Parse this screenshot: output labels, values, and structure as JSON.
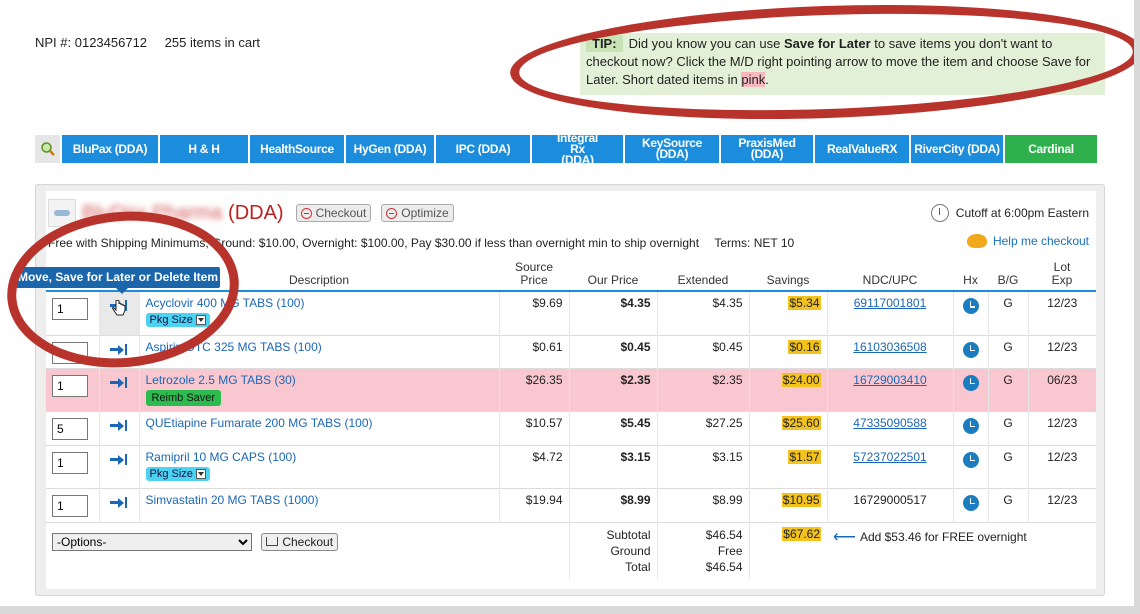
{
  "header": {
    "npi": "NPI #: 0123456712",
    "cart_count": "255 items in cart"
  },
  "tip": {
    "label": "TIP:",
    "text_1": "Did you know you can use ",
    "bold": "Save for Later",
    "text_2": " to save items you don't want to checkout now? Click the M/D right pointing arrow to move the item and choose Save for Later. Short dated items in ",
    "pink": "pink",
    "text_3": "."
  },
  "vendor_tabs": [
    {
      "label": "BluPax (DDA)",
      "color": "#1c8ddc"
    },
    {
      "label": "H & H",
      "color": "#1c8ddc"
    },
    {
      "label": "HealthSource",
      "color": "#1c8ddc"
    },
    {
      "label": "HyGen (DDA)",
      "color": "#1c8ddc"
    },
    {
      "label": "IPC (DDA)",
      "color": "#1c8ddc"
    },
    {
      "label": "Integral Rx (DDA)",
      "color": "#1c8ddc"
    },
    {
      "label": "KeySource (DDA)",
      "color": "#1c8ddc"
    },
    {
      "label": "PraxisMed (DDA)",
      "color": "#1c8ddc"
    },
    {
      "label": "RealValueRX",
      "color": "#1c8ddc"
    },
    {
      "label": "RiverCity (DDA)",
      "color": "#1c8ddc"
    },
    {
      "label": "Cardinal",
      "color": "#2eb14d"
    }
  ],
  "vendor": {
    "name_blurred": "BluDirx Pharma",
    "suffix": "(DDA)",
    "checkout_label": "Checkout",
    "optimize_label": "Optimize",
    "cutoff": "Cutoff at 6:00pm Eastern",
    "shipping": "Free with Shipping Minimums, Ground: $10.00, Overnight: $100.00, Pay $30.00 if less than overnight min to ship overnight",
    "terms": "Terms: NET 10",
    "help": "Help me checkout"
  },
  "tooltip": "Move, Save for Later or Delete Item",
  "columns": {
    "description": "Description",
    "source_price_1": "Source",
    "source_price_2": "Price",
    "our_price": "Our Price",
    "extended": "Extended",
    "savings": "Savings",
    "ndc": "NDC/UPC",
    "hx": "Hx",
    "bg": "B/G",
    "lot_1": "Lot",
    "lot_2": "Exp"
  },
  "rows": [
    {
      "qty": "1",
      "desc": "Acyclovir 400 MG TABS (100)",
      "badge": "Pkg Size",
      "source": "$9.69",
      "our": "$4.35",
      "ext": "$4.35",
      "savings": "$5.34",
      "ndc": "69117001801",
      "bg": "G",
      "lot": "12/23"
    },
    {
      "qty": "1",
      "desc": "Aspirin OTC 325 MG TABS (100)",
      "badge": "",
      "source": "$0.61",
      "our": "$0.45",
      "ext": "$0.45",
      "savings": "$0.16",
      "ndc": "16103036508",
      "bg": "G",
      "lot": "12/23"
    },
    {
      "qty": "1",
      "desc": "Letrozole 2.5 MG TABS (30)",
      "badge": "Reimb Saver",
      "source": "$26.35",
      "our": "$2.35",
      "ext": "$2.35",
      "savings": "$24.00",
      "ndc": "16729003410",
      "bg": "G",
      "lot": "06/23"
    },
    {
      "qty": "5",
      "desc": "QUEtiapine Fumarate 200 MG TABS (100)",
      "badge": "",
      "source": "$10.57",
      "our": "$5.45",
      "ext": "$27.25",
      "savings": "$25.60",
      "ndc": "47335090588",
      "bg": "G",
      "lot": "12/23"
    },
    {
      "qty": "1",
      "desc": "Ramipril 10 MG CAPS (100)",
      "badge": "Pkg Size",
      "source": "$4.72",
      "our": "$3.15",
      "ext": "$3.15",
      "savings": "$1.57",
      "ndc": "57237022501",
      "bg": "G",
      "lot": "12/23"
    },
    {
      "qty": "1",
      "desc": "Simvastatin 20 MG TABS (1000)",
      "badge": "",
      "source": "$19.94",
      "our": "$8.99",
      "ext": "$8.99",
      "savings": "$10.95",
      "ndc": "16729000517",
      "bg": "G",
      "lot": "12/23"
    }
  ],
  "footer": {
    "options": "-Options-",
    "checkout": "Checkout",
    "subtotal_label": "Subtotal",
    "ground_label": "Ground",
    "total_label": "Total",
    "subtotal": "$46.54",
    "ground": "Free",
    "total": "$46.54",
    "savings_total": "$67.62",
    "free_overnight": "Add $53.46 for FREE overnight"
  },
  "colors": {
    "tab_blue": "#1c8ddc",
    "tab_green": "#2eb14d",
    "short_dated_pink": "#f8c7cf",
    "savings_yellow": "#f3c21c",
    "annotation_red": "#b8332c"
  }
}
